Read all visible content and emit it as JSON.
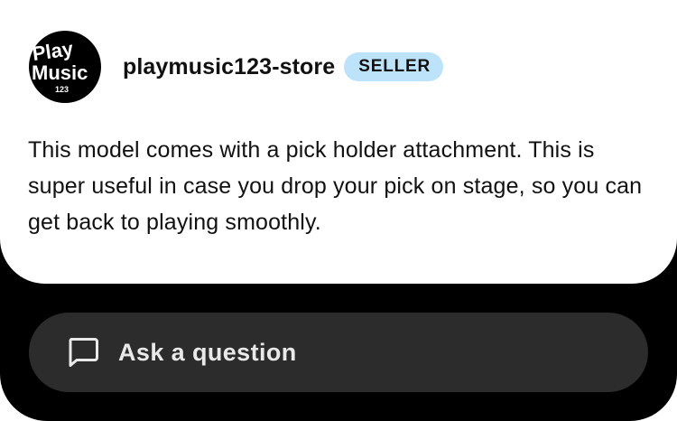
{
  "seller": {
    "logo_text_line1": "Play",
    "logo_text_line2": "Music",
    "logo_text_line3": "123",
    "store_name": "playmusic123-store",
    "badge": "SELLER"
  },
  "description": "This model comes with a pick holder attachment. This is super useful in case you drop your pick on stage, so you can get back to playing smoothly.",
  "ask_button": {
    "label": "Ask a question",
    "icon": "chat-bubble-icon"
  },
  "colors": {
    "background": "#000000",
    "card": "#ffffff",
    "badge_bg": "#bde3fb",
    "button_bg": "#2c2c2c",
    "button_text": "#e9e9e9"
  }
}
